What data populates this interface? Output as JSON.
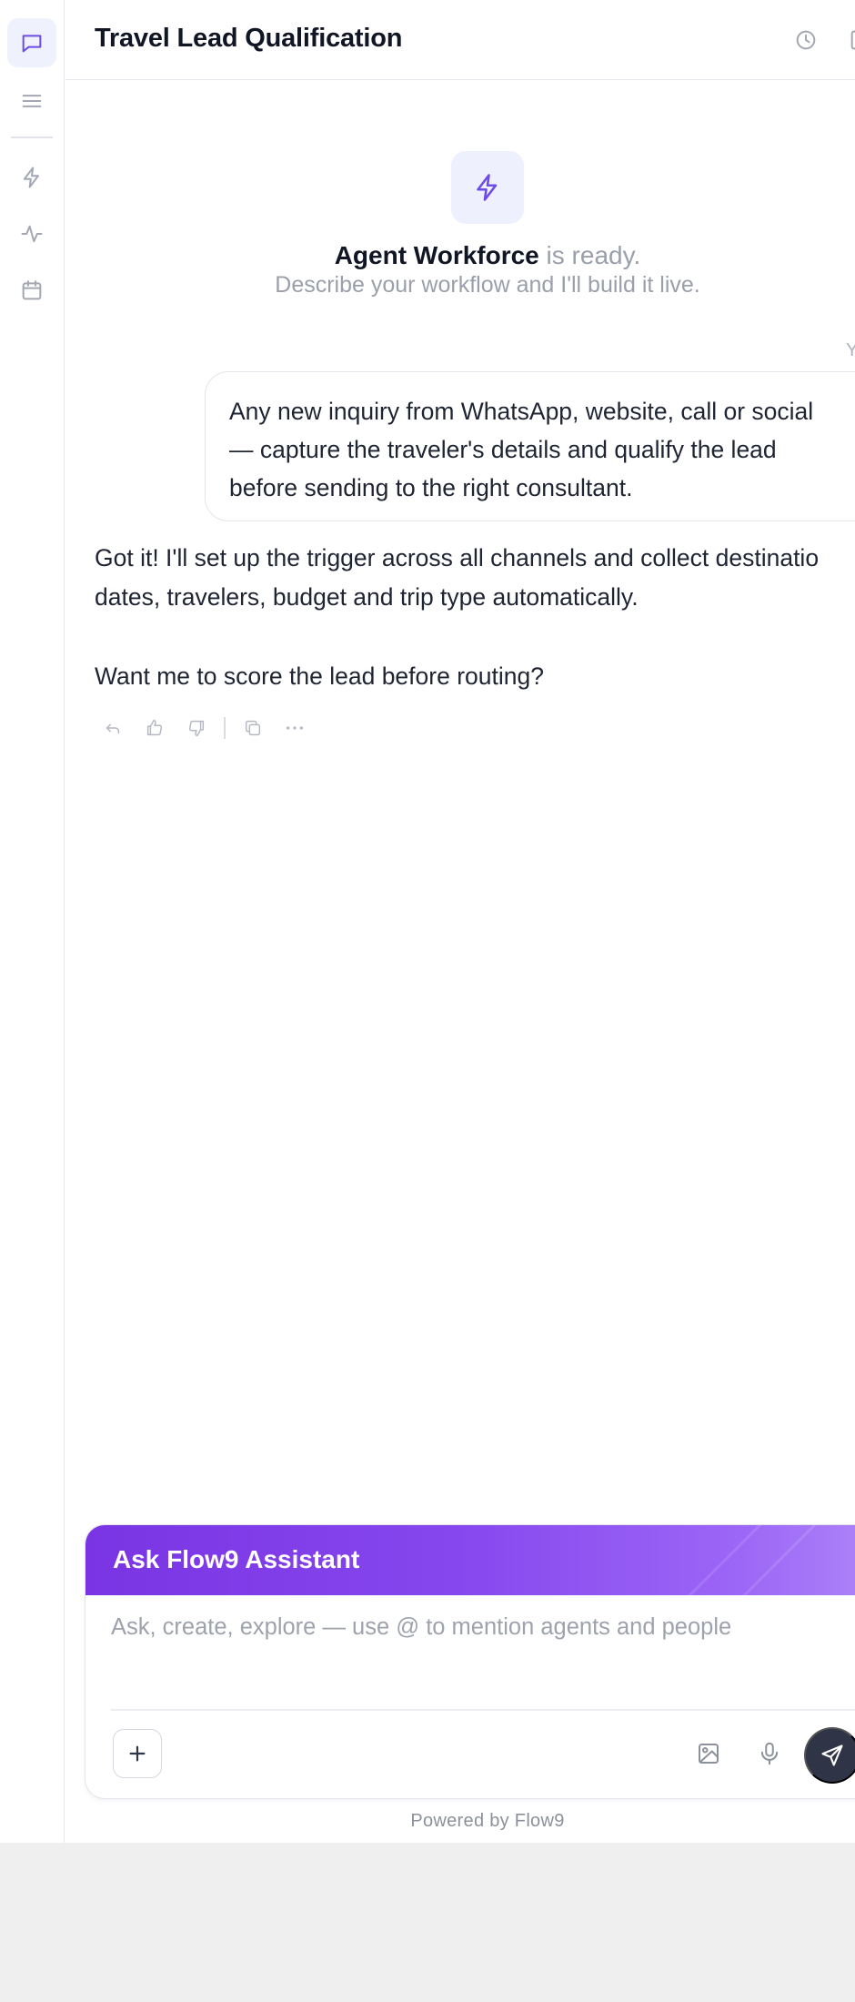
{
  "header": {
    "title": "Travel Lead Qualification"
  },
  "sidebar": {
    "items": [
      {
        "name": "chat-icon",
        "active": true
      },
      {
        "name": "menu-icon",
        "active": false
      },
      {
        "name": "lightning-icon",
        "active": false
      },
      {
        "name": "activity-icon",
        "active": false
      },
      {
        "name": "calendar-icon",
        "active": false
      }
    ]
  },
  "hero": {
    "icon": "lightning-icon",
    "title_bold": "Agent Workforce",
    "title_light": "is ready.",
    "subtitle": "Describe your workflow and I'll build it live."
  },
  "conversation": {
    "user_label": "Y",
    "user_message_lines": [
      "Any new inquiry from WhatsApp, website, call or social",
      "— capture the traveler's details and qualify the lead",
      "before sending to the right consultant."
    ],
    "assistant_lines": [
      "Got it! I'll set up the trigger across all channels and collect destinatio",
      "dates, travelers, budget and trip type automatically."
    ],
    "assistant_question": "Want me to score the lead before routing?",
    "actions": [
      "reply-icon",
      "thumbs-up-icon",
      "thumbs-down-icon",
      "copy-icon",
      "more-icon"
    ]
  },
  "composer": {
    "title": "Ask Flow9 Assistant",
    "placeholder": "Ask, create, explore — use @ to mention agents and people",
    "plus_label": "+",
    "tools": [
      "image-icon",
      "microphone-icon",
      "send-icon"
    ]
  },
  "footer": {
    "powered": "Powered by Flow9"
  },
  "colors": {
    "accent": "#7b3fe4",
    "accent_light": "#eef0fd",
    "send_button": "#2f3446",
    "muted_text": "#9a9fab"
  }
}
